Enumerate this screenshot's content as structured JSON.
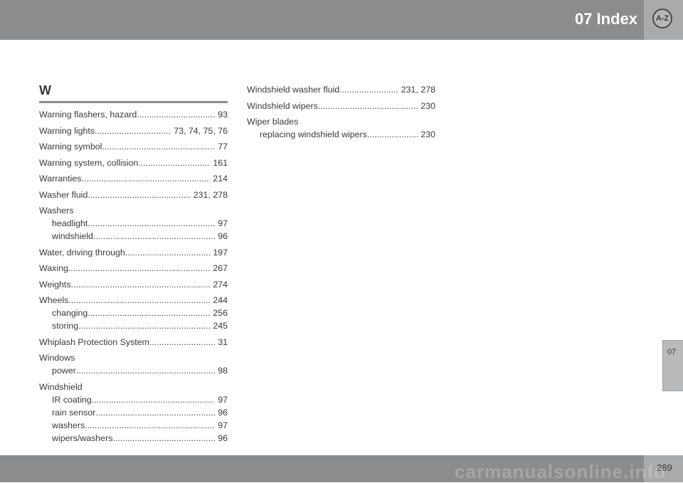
{
  "header": {
    "title": "07 Index",
    "badge": "A-Z"
  },
  "side_tab": {
    "label": "07"
  },
  "footer": {
    "page_number": "289"
  },
  "watermark": "carmanualsonline.info",
  "section": {
    "letter": "W"
  },
  "columns": [
    [
      {
        "lines": [
          {
            "label": "Warning flashers, hazard",
            "pages": "93"
          }
        ]
      },
      {
        "lines": [
          {
            "label": "Warning lights",
            "pages": "73, 74, 75, 76"
          }
        ]
      },
      {
        "lines": [
          {
            "label": "Warning symbol",
            "pages": "77"
          }
        ]
      },
      {
        "lines": [
          {
            "label": "Warning system, collision",
            "pages": "161"
          }
        ]
      },
      {
        "lines": [
          {
            "label": "Warranties",
            "pages": "214"
          }
        ]
      },
      {
        "lines": [
          {
            "label": "Washer fluid",
            "pages": "231, 278"
          }
        ]
      },
      {
        "lines": [
          {
            "label": "Washers",
            "pages": ""
          },
          {
            "label": "headlight",
            "pages": "97",
            "sub": true
          },
          {
            "label": "windshield",
            "pages": "96",
            "sub": true
          }
        ]
      },
      {
        "lines": [
          {
            "label": "Water, driving through",
            "pages": "197"
          }
        ]
      },
      {
        "lines": [
          {
            "label": "Waxing",
            "pages": "267"
          }
        ]
      },
      {
        "lines": [
          {
            "label": "Weights",
            "pages": "274"
          }
        ]
      },
      {
        "lines": [
          {
            "label": "Wheels",
            "pages": "244"
          },
          {
            "label": "changing",
            "pages": "256",
            "sub": true
          },
          {
            "label": "storing",
            "pages": "245",
            "sub": true
          }
        ]
      },
      {
        "lines": [
          {
            "label": "Whiplash Protection System",
            "pages": "31"
          }
        ]
      },
      {
        "lines": [
          {
            "label": "Windows",
            "pages": ""
          },
          {
            "label": "power",
            "pages": "98",
            "sub": true
          }
        ]
      },
      {
        "lines": [
          {
            "label": "Windshield",
            "pages": ""
          },
          {
            "label": "IR coating",
            "pages": "97",
            "sub": true
          },
          {
            "label": "rain sensor",
            "pages": "96",
            "sub": true
          },
          {
            "label": "washers",
            "pages": "97",
            "sub": true
          },
          {
            "label": "wipers/washers",
            "pages": "96",
            "sub": true
          }
        ]
      }
    ],
    [
      {
        "lines": [
          {
            "label": "Windshield washer fluid",
            "pages": "231, 278"
          }
        ]
      },
      {
        "lines": [
          {
            "label": "Windshield wipers",
            "pages": "230"
          }
        ]
      },
      {
        "lines": [
          {
            "label": "Wiper blades",
            "pages": ""
          },
          {
            "label": "replacing windshield wipers",
            "pages": "230",
            "sub": true
          }
        ]
      }
    ]
  ]
}
